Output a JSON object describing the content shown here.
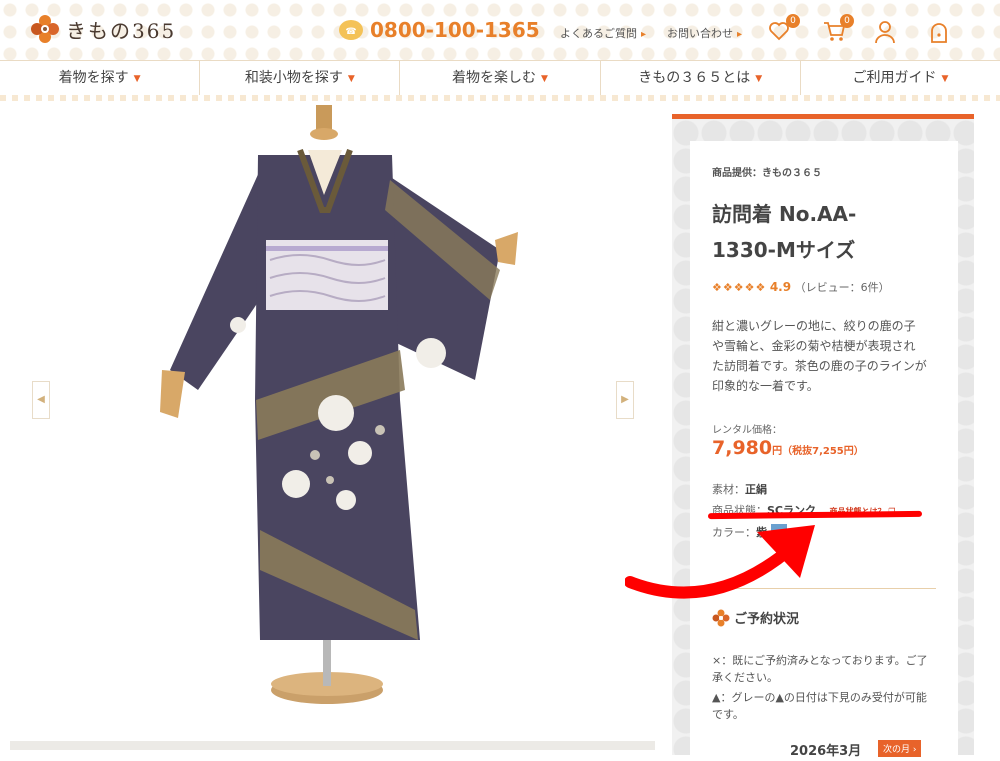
{
  "header": {
    "logo_text": "きもの365",
    "phone": "0800-100-1365",
    "links": [
      "よくあるご質問",
      "お問い合わせ"
    ],
    "favorite_count": "0",
    "cart_count": "0"
  },
  "nav": {
    "items": [
      "着物を探す",
      "和装小物を探す",
      "着物を楽しむ",
      "きもの３６５とは",
      "ご利用ガイド"
    ]
  },
  "product": {
    "provider": "商品提供：きもの３６５",
    "title": "訪問着 No.AA-1330-Mサイズ",
    "stars": "❖❖❖❖❖",
    "rating": "4.9",
    "reviews": "（レビュー：6件）",
    "description": "紺と濃いグレーの地に、絞りの鹿の子や雪輪と、金彩の菊や桔梗が表現された訪問着です。茶色の鹿の子のラインが印象的な一着です。",
    "price_label": "レンタル価格：",
    "price": "7,980",
    "price_unit": "円",
    "price_tax": "（税抜7,255円）",
    "material_label": "素材：",
    "material": "正絹",
    "condition_label": "商品状態：",
    "condition": "SCランク",
    "condition_link": "商品状態とは？",
    "color_label": "カラー：",
    "color_value": "紫",
    "color_swatch": "#6aa0cf"
  },
  "reservation": {
    "title": "ご予約状況",
    "note1": "×：既にご予約済みとなっております。ご了承ください。",
    "note2": "▲：グレーの▲の日付は下見のみ受付が可能です。",
    "month": "2026年3月",
    "next": "次の月 ›"
  },
  "colors": {
    "accent": "#e8632a",
    "orange": "#e8802a",
    "kimono": "#4a4560"
  }
}
